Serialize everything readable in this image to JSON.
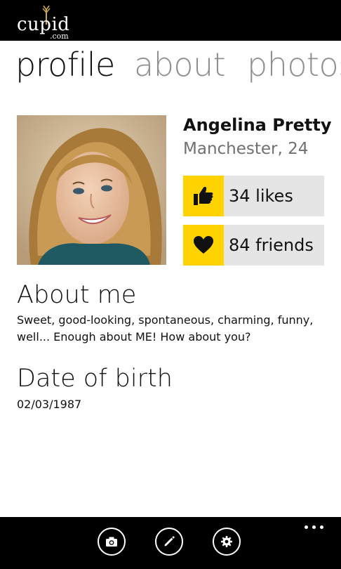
{
  "app": {
    "logo_text": "cupid",
    "logo_sub": ".com"
  },
  "pivot": {
    "tabs": [
      {
        "label": "profile",
        "active": true
      },
      {
        "label": "about",
        "active": false
      },
      {
        "label": "photos",
        "active": false
      }
    ]
  },
  "profile": {
    "name": "Angelina Pretty",
    "location": "Manchester, 24",
    "stats": {
      "likes": "34 likes",
      "friends": "84 friends"
    }
  },
  "about": {
    "title": "About me",
    "body": "Sweet, good-looking, spontaneous, charming, funny, well...  Enough about ME! How about you?"
  },
  "dob": {
    "title": "Date of birth",
    "value": "02/03/1987"
  },
  "appbar": {
    "buttons": [
      "camera-icon",
      "pencil-icon",
      "gear-icon"
    ],
    "more": "ellipsis-icon"
  },
  "colors": {
    "accent": "#ffd200",
    "tile_bg": "#e5e5e5",
    "chrome": "#000000",
    "inactive_tab": "#8f8f8f",
    "secondary_text": "#707070"
  }
}
